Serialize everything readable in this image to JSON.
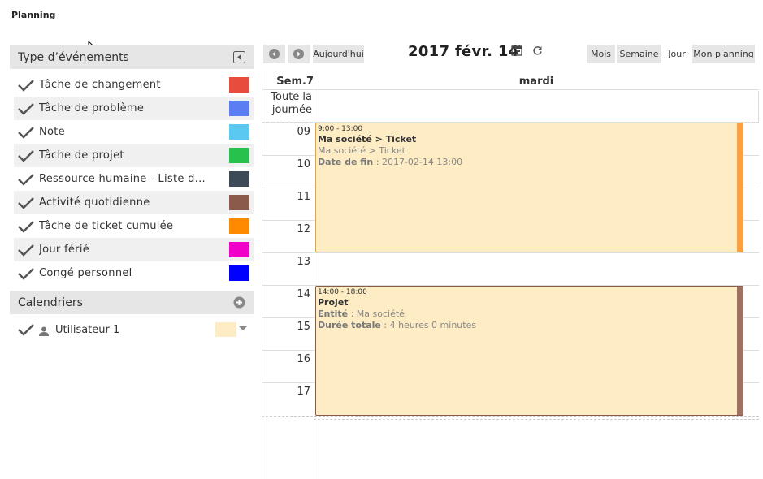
{
  "page": {
    "title": "Planning"
  },
  "sidebar": {
    "event_types_header": "Type d’événements",
    "event_types": [
      {
        "label": "Tâche de changement",
        "color": "#e74c3c"
      },
      {
        "label": "Tâche de problème",
        "color": "#5b7ff2"
      },
      {
        "label": "Note",
        "color": "#5bc8f2"
      },
      {
        "label": "Tâche de projet",
        "color": "#27c24c"
      },
      {
        "label": "Ressource humaine - Liste d...",
        "color": "#3d4a57"
      },
      {
        "label": "Activité quotidienne",
        "color": "#8b5a4a"
      },
      {
        "label": "Tâche de ticket cumulée",
        "color": "#ff8a00"
      },
      {
        "label": "Jour férié",
        "color": "#f000c8"
      },
      {
        "label": "Congé personnel",
        "color": "#0000ff"
      }
    ],
    "calendars_header": "Calendriers",
    "calendars": [
      {
        "label": "Utilisateur 1",
        "color": "#fdecc4"
      }
    ]
  },
  "toolbar": {
    "prev_icon": "chevron-left-circle-icon",
    "next_icon": "chevron-right-circle-icon",
    "today_label": "Aujourd'hui",
    "date_title": "2017 févr. 14",
    "views": [
      "Mois",
      "Semaine",
      "Jour",
      "Mon planning"
    ],
    "active_view": "Jour"
  },
  "calendar": {
    "week_label": "Sem.7",
    "day_label": "mardi",
    "allday_label": "Toute la journée",
    "hours": [
      "09",
      "10",
      "11",
      "12",
      "13",
      "14",
      "15",
      "16",
      "17"
    ],
    "events": [
      {
        "time": "9:00 - 13:00",
        "title": "Ma société > Ticket",
        "subtitle": "Ma société > Ticket",
        "detail_key": "Date de fin",
        "detail_value": "2017-02-14 13:00",
        "border_color": "#f0a030",
        "bar_color": "#ffa040"
      },
      {
        "time": "14:00 - 18:00",
        "title": "Projet",
        "detail_key": "Entité",
        "detail_value": "Ma société",
        "detail2_key": "Durée totale",
        "detail2_value": "4 heures 0 minutes",
        "border_color": "#8b5a4a",
        "bar_color": "#a07060"
      }
    ]
  }
}
